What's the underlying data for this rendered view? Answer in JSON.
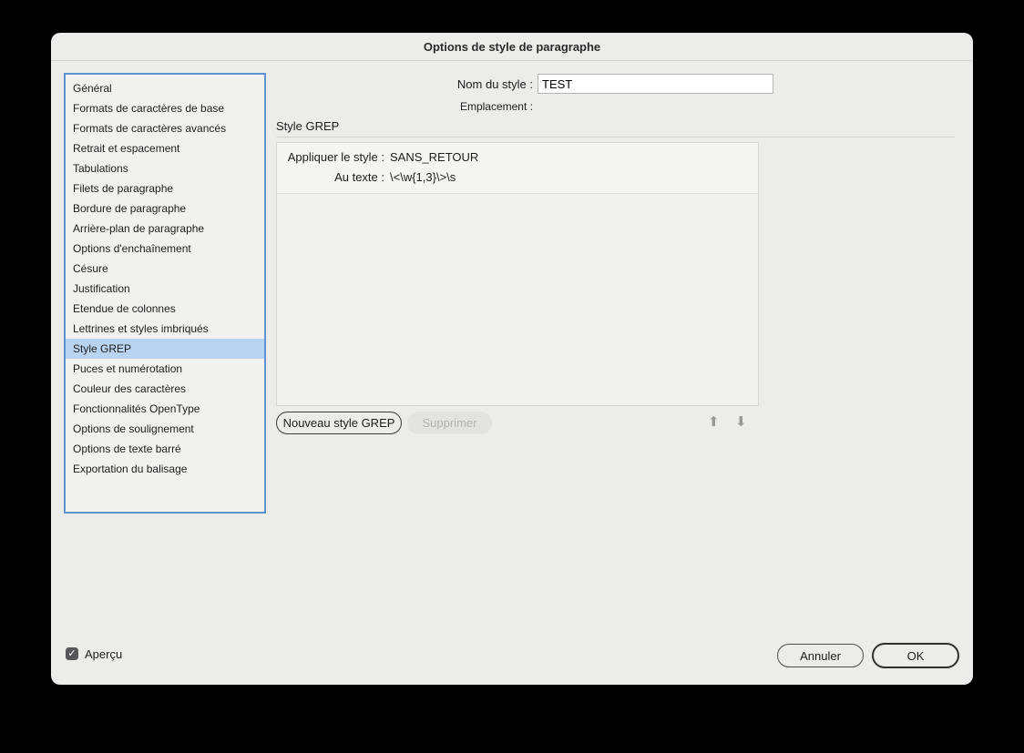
{
  "window": {
    "title": "Options de style de paragraphe"
  },
  "sidebar": {
    "items": [
      "Général",
      "Formats de caractères de base",
      "Formats de caractères avancés",
      "Retrait et espacement",
      "Tabulations",
      "Filets de paragraphe",
      "Bordure de paragraphe",
      "Arrière-plan de paragraphe",
      "Options d'enchaînement",
      "Césure",
      "Justification",
      "Etendue de colonnes",
      "Lettrines et styles imbriqués",
      "Style GREP",
      "Puces et numérotation",
      "Couleur des caractères",
      "Fonctionnalités OpenType",
      "Options de soulignement",
      "Options de texte barré",
      "Exportation du balisage"
    ],
    "selected_index": 13,
    "selected_item": "Style GREP"
  },
  "name_field": {
    "label": "Nom du style :",
    "value": "TEST"
  },
  "location": {
    "label": "Emplacement :",
    "value": ""
  },
  "grep": {
    "header": "Style GREP",
    "entry": {
      "apply_label": "Appliquer le style :",
      "apply_value": "SANS_RETOUR",
      "to_text_label": "Au texte :",
      "to_text_value": "\\<\\w{1,3}\\>\\s"
    }
  },
  "buttons": {
    "new_grep": "Nouveau style GREP",
    "delete": "Supprimer",
    "cancel": "Annuler",
    "ok": "OK"
  },
  "preview": {
    "label": "Aperçu",
    "checked": true
  },
  "icons": {
    "up": "⬆",
    "down": "⬇",
    "check": "✓"
  },
  "colors": {
    "dialog_bg": "#ececeb",
    "selection": "#b9d4f0",
    "focus_ring": "#5d92d3",
    "disabled_text": "#b3b3b1"
  }
}
